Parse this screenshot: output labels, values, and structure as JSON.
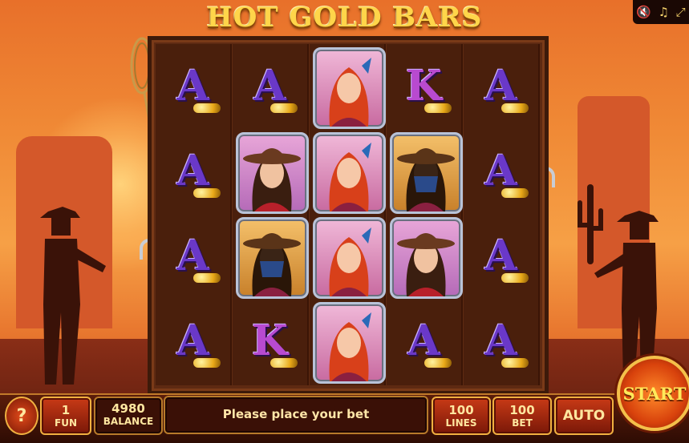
{
  "game": {
    "title": "HOT GOLD BARS"
  },
  "top_controls": {
    "mute_icon": "speaker-mute-icon",
    "music_icon": "music-icon",
    "fullscreen_icon": "fullscreen-icon"
  },
  "reels": [
    [
      "A",
      "A",
      "A",
      "A"
    ],
    [
      "A",
      "cowgirl",
      "bandit",
      "K"
    ],
    [
      "redhead",
      "redhead",
      "redhead",
      "redhead"
    ],
    [
      "K",
      "bandit",
      "cowgirl",
      "A"
    ],
    [
      "A",
      "A",
      "A",
      "A"
    ]
  ],
  "bottom_bar": {
    "help_label": "?",
    "fun": {
      "value": "1",
      "label": "FUN"
    },
    "balance": {
      "value": "4980",
      "label": "BALANCE"
    },
    "message": "Please place your bet",
    "lines": {
      "value": "100",
      "label": "LINES"
    },
    "bet": {
      "value": "100",
      "label": "BET"
    },
    "auto_label": "AUTO",
    "start_label": "START"
  },
  "colors": {
    "accent": "#f0b040",
    "title": "#ffd54a",
    "letter_a": "#6a38c8",
    "letter_k": "#b84ad0"
  }
}
